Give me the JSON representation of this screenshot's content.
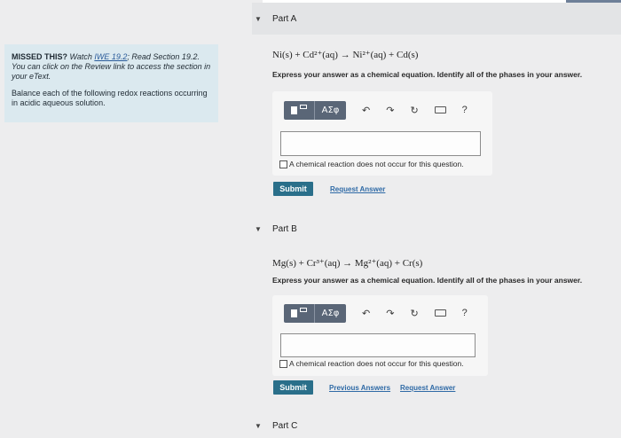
{
  "sidebar": {
    "hint_bold": "MISSED THIS?",
    "hint_pre": " Watch ",
    "hint_link": "IWE 19.2",
    "hint_post": "; Read Section 19.2. You can click on the Review link to access the section in your eText.",
    "instruction": "Balance each of the following redox reactions occurring in acidic aqueous solution."
  },
  "part_a": {
    "label": "Part A",
    "equation": "Ni(s) + Cd²⁺(aq) → Ni²⁺(aq) + Cd(s)",
    "instruction": "Express your answer as a chemical equation. Identify all of the phases in your answer.",
    "input_value": "",
    "no_reaction_label": "A chemical reaction does not occur for this question.",
    "submit_label": "Submit",
    "links": [
      "Request Answer"
    ]
  },
  "part_b": {
    "label": "Part B",
    "equation": "Mg(s) + Cr³⁺(aq) → Mg²⁺(aq) + Cr(s)",
    "instruction": "Express your answer as a chemical equation. Identify all of the phases in your answer.",
    "input_value": "",
    "no_reaction_label": "A chemical reaction does not occur for this question.",
    "submit_label": "Submit",
    "links": [
      "Previous Answers",
      "Request Answer"
    ]
  },
  "part_c": {
    "label": "Part C"
  },
  "toolbar": {
    "greek_label": "ΑΣφ",
    "undo_glyph": "↶",
    "redo_glyph": "↷",
    "reset_glyph": "↻",
    "help_glyph": "?"
  },
  "icons": {
    "caret": "▼",
    "templates": "templates-icon",
    "keyboard": "keyboard-icon"
  },
  "colors": {
    "submit": "#2a6f8a",
    "link": "#2f6aa6",
    "sidebar_bg": "#dbe9ef",
    "toolbar_btn": "#5a6677"
  }
}
